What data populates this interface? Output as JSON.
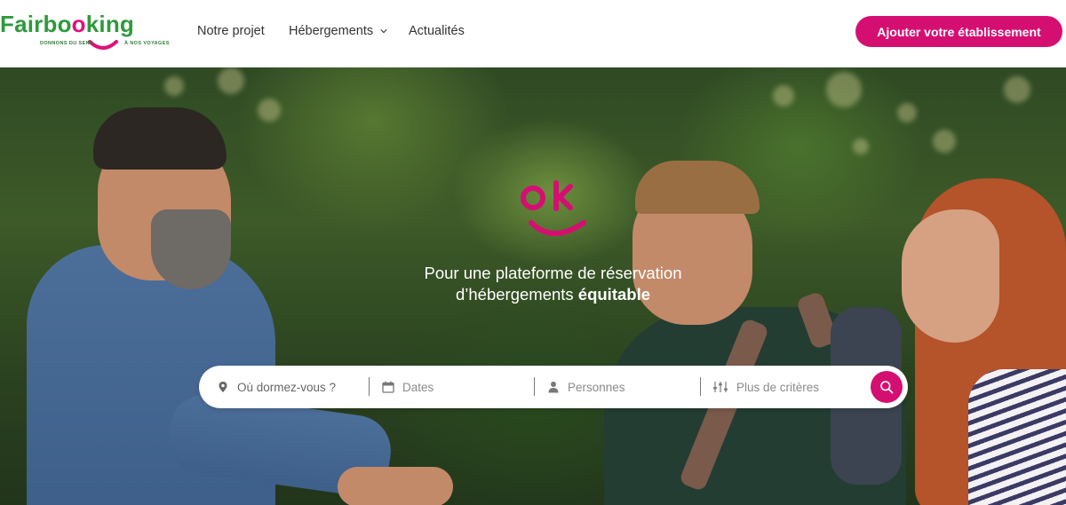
{
  "brand": {
    "logo_word_part1": "Fairbo",
    "logo_word_o": "o",
    "logo_word_part2": "king",
    "logo_tag_left": "DONNONS DU SENS",
    "logo_tag_right": "À NOS VOYAGES",
    "pink": "#d50f72",
    "green": "#2e9a3c"
  },
  "nav": {
    "items": [
      {
        "label": "Notre projet",
        "has_dropdown": false
      },
      {
        "label": "Hébergements",
        "has_dropdown": true,
        "icon": "chevron-down-icon"
      },
      {
        "label": "Actualités",
        "has_dropdown": false
      }
    ],
    "cta_label": "Ajouter votre établissement"
  },
  "hero": {
    "badge_text": "ok",
    "tagline_line1": "Pour une plateforme de réservation",
    "tagline_line2_prefix": "d’hébergements ",
    "tagline_line2_bold": "équitable"
  },
  "search": {
    "where_placeholder": "Où dormez-vous ?",
    "where_icon": "map-pin-icon",
    "dates_placeholder": "Dates",
    "dates_icon": "calendar-icon",
    "persons_placeholder": "Personnes",
    "persons_icon": "person-icon",
    "criteria_placeholder": "Plus de critères",
    "criteria_icon": "sliders-icon",
    "submit_icon": "search-icon"
  }
}
